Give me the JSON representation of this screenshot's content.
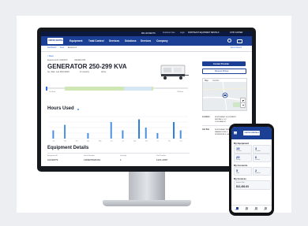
{
  "utility_bar": {
    "phone": "800.UR.RENTS",
    "links": [
      "Customer Care",
      "Login"
    ],
    "account": "NORTHEAST EQUIPMENT RENTALS",
    "user": "JOHN CARTER"
  },
  "nav": {
    "logo": "UNITED RENTALS",
    "items": [
      "Equipment",
      "Total Control",
      "Services",
      "Solutions",
      "Services",
      "Company"
    ]
  },
  "breadcrumbs": [
    "Dashboard",
    "Fleet",
    "Equipment"
  ],
  "breadcrumb_right": "Export Report",
  "equipment": {
    "back": "< Back",
    "equipment_id": "Equipment ID: 10240079",
    "category": "GENERATOR",
    "title": "GENERATOR 250-299 KVA",
    "meta": [
      "Ser. Rate: Low 48/10 MAIN",
      "In Inventory",
      "Active"
    ],
    "timeline_left": "On Rent",
    "timeline_right": "Off Rent"
  },
  "actions": {
    "primary": "Contact Provider",
    "secondary": "Request Pickup"
  },
  "map": {
    "tabs": [
      "Map",
      "Satellite"
    ]
  },
  "location": {
    "label": "Location",
    "lines": [
      "NORTHEAST EQUIPMENT",
      "RENTALS, LLC",
      "1234 MAIN ST"
    ],
    "label2": "Job Site",
    "lines2": [
      "NORTHEAST RENTALS",
      "WAREHOUSE 4",
      "SPRINGFIELD, MA"
    ]
  },
  "hours_used": {
    "title": "Hours Used"
  },
  "chart_data": {
    "type": "bar",
    "categories": [
      "Jan",
      "Feb",
      "Mar",
      "Apr",
      "May",
      "Jun",
      "Jul",
      "Aug",
      "Sep",
      "Oct",
      "Nov",
      "Dec"
    ],
    "series": [
      {
        "values": [
          3,
          5,
          0,
          2,
          0,
          6,
          3,
          0,
          4,
          2,
          0,
          3
        ]
      },
      {
        "values": [
          0,
          0,
          0,
          0,
          0,
          0,
          0,
          7,
          0,
          0,
          6,
          0
        ]
      }
    ],
    "ylim": [
      0,
      8
    ],
    "colors": [
      "#4a90e2",
      "#2f7bd8"
    ]
  },
  "details": {
    "title": "Equipment Details",
    "fields": [
      {
        "label": "Equipment ID",
        "value": "10240079"
      },
      {
        "label": "Serial Number",
        "value": "13DEP0820461"
      },
      {
        "label": "Quantity",
        "value": "1"
      },
      {
        "label": "Part Number",
        "value": "1221-0087"
      }
    ]
  },
  "mobile": {
    "logo": "UNITED RENTALS",
    "section1": "My Equipment",
    "stats1": [
      {
        "value": "15",
        "label": "On Rent"
      },
      {
        "value": "3",
        "label": "Overdue"
      }
    ],
    "stats2": [
      {
        "value": "25",
        "label": "Pickup"
      },
      {
        "value": "6",
        "label": "Service"
      }
    ],
    "section2": "My Accounts",
    "stats3": [
      {
        "value": "5",
        "label": "Jobs"
      },
      {
        "value": "2",
        "label": "Invoices"
      }
    ],
    "section3": "My Invoices",
    "invoice": "Invoice Due",
    "invoice_amount": "$12,481.63",
    "tabs": [
      "Home",
      "Fleet",
      "Orders",
      "More"
    ]
  },
  "colors": {
    "navy": "#0b1840",
    "brand_blue": "#1b3f94",
    "accent": "#2f6ad9",
    "chart_bar": "#4a90e2",
    "timeline": "#cfe7b4"
  }
}
